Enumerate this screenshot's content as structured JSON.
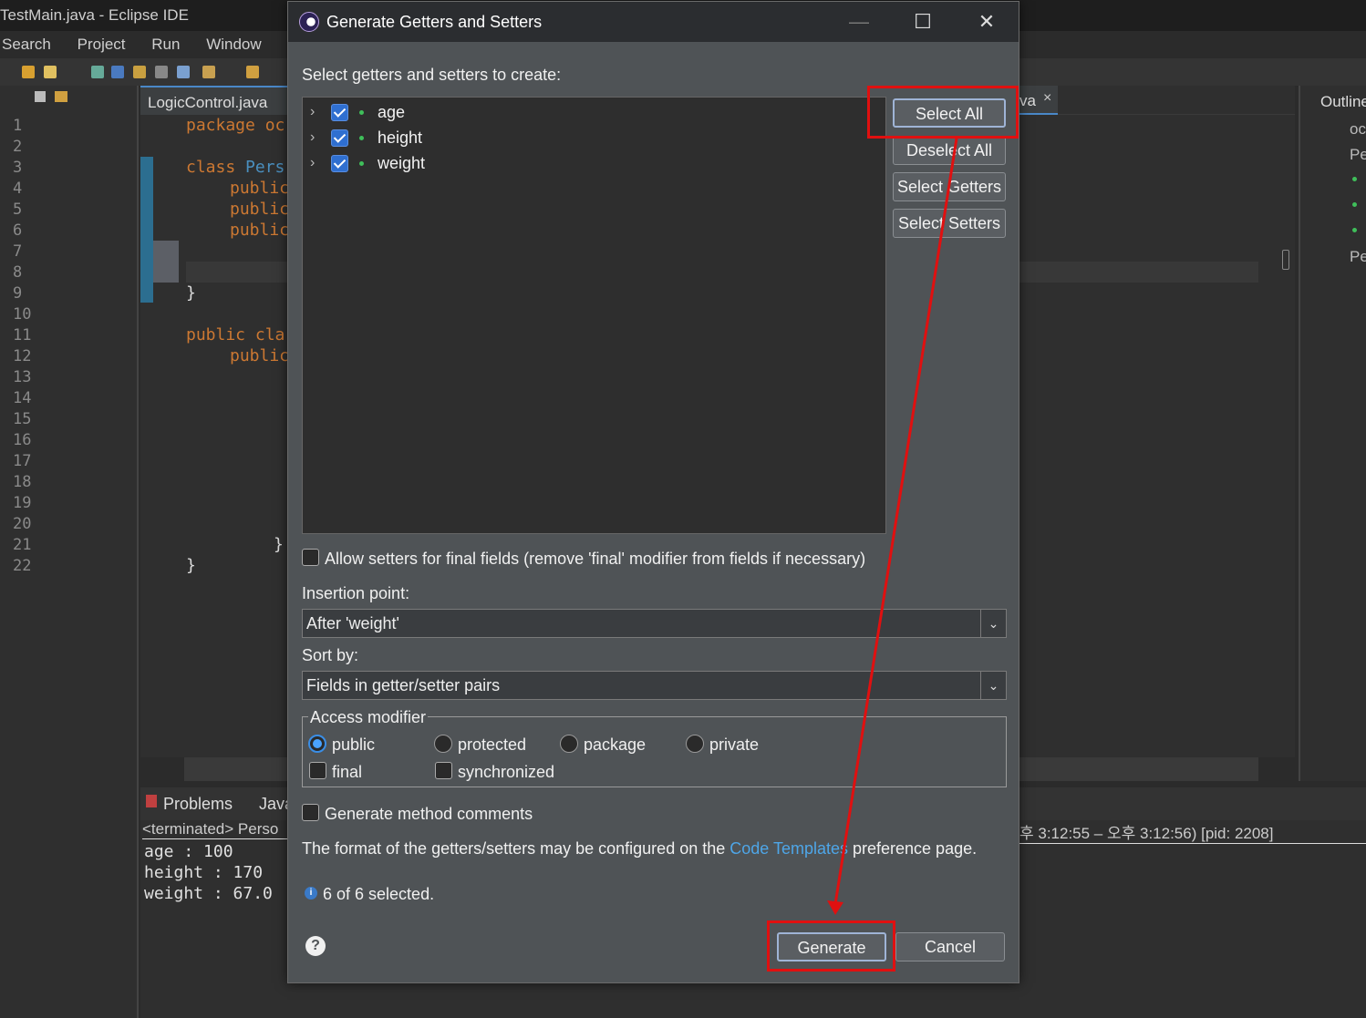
{
  "ide": {
    "window_title": "TestMain.java - Eclipse IDE",
    "menu": [
      "Search",
      "Project",
      "Run",
      "Window"
    ],
    "editor_tab": "LogicControl.java",
    "second_tab_fragment": "va",
    "outline_title": "Outline",
    "line_numbers": [
      "1",
      "2",
      "3",
      "4",
      "5",
      "6",
      "7",
      "8",
      "9",
      "10",
      "11",
      "12",
      "13",
      "14",
      "15",
      "16",
      "17",
      "18",
      "19",
      "20",
      "21",
      "22"
    ],
    "code_fragments": {
      "l1": "package oc",
      "l3a": "class ",
      "l3b": "Pers",
      "l4": "public",
      "l5": "public",
      "l6": "public",
      "l9": "}",
      "l11": "public cla",
      "l12": "public",
      "l21": "}",
      "l22": "}"
    },
    "outline_items": [
      "oc",
      "Pe",
      "Pe"
    ],
    "console": {
      "tab_problems": "Problems",
      "tab_java": "Java",
      "terminated": "<terminated> Perso",
      "terminated_tail": "후 3:12:55 – 오후 3:12:56) [pid: 2208]",
      "lines": [
        "age : 100",
        "height : 170",
        "weight : 67.0"
      ]
    }
  },
  "dialog": {
    "title": "Generate Getters and Setters",
    "prompt": "Select getters and setters to create:",
    "fields": [
      {
        "name": "age",
        "checked": true
      },
      {
        "name": "height",
        "checked": true
      },
      {
        "name": "weight",
        "checked": true
      }
    ],
    "buttons": {
      "select_all": "Select All",
      "deselect_all": "Deselect All",
      "select_getters": "Select Getters",
      "select_setters": "Select Setters",
      "generate": "Generate",
      "cancel": "Cancel"
    },
    "allow_final_setters": "Allow setters for final fields (remove 'final' modifier from fields if necessary)",
    "insertion_point_label": "Insertion point:",
    "insertion_point_value": "After 'weight'",
    "sort_by_label": "Sort by:",
    "sort_by_value": "Fields in getter/setter pairs",
    "access_modifier_label": "Access modifier",
    "access_modifiers": [
      "public",
      "protected",
      "package",
      "private"
    ],
    "selected_modifier": "public",
    "final_label": "final",
    "synchronized_label": "synchronized",
    "generate_comments": "Generate method comments",
    "format_text_before": "The format of the getters/setters may be configured on the ",
    "format_link": "Code Templates",
    "format_text_after": " preference page.",
    "status": "6 of 6 selected."
  },
  "annotation_color": "#e01010"
}
